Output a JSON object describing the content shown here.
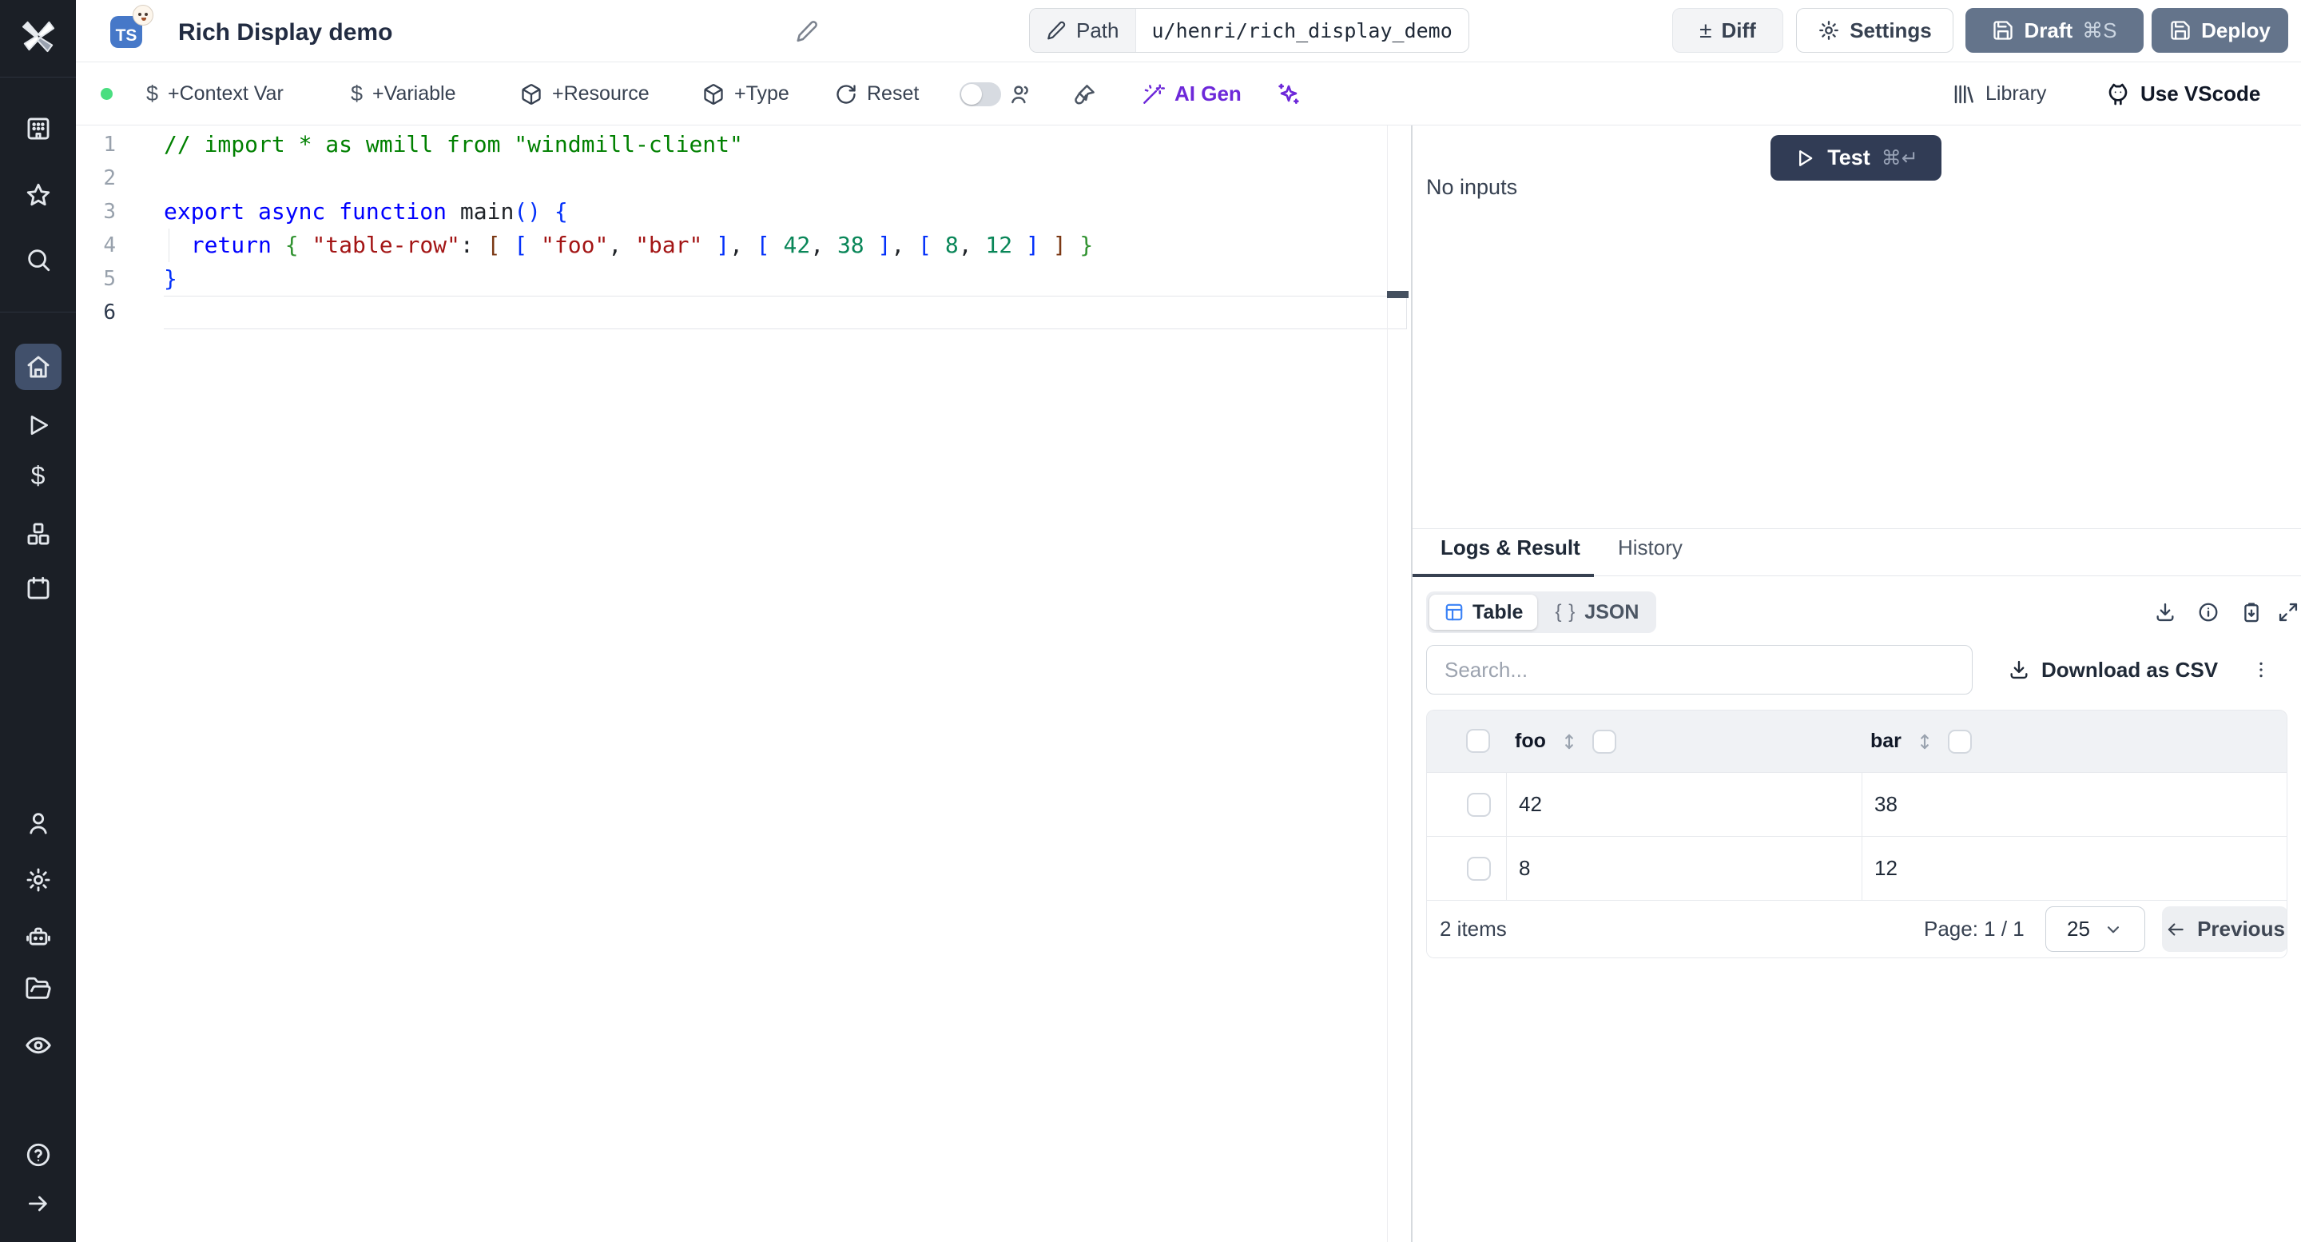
{
  "colors": {
    "accent_slate": "#64748b",
    "test_button": "#313c55",
    "ai_violet": "#6d28d9",
    "status_green": "#4ade80",
    "ts_badge_blue": "#4678c8",
    "table_icon_blue": "#3b82f6",
    "sidebar_bg": "#1b1f26"
  },
  "header": {
    "language_badge": "TS",
    "title": "Rich Display demo",
    "path_label": "Path",
    "path_value": "u/henri/rich_display_demo",
    "diff": "Diff",
    "settings": "Settings",
    "draft": "Draft",
    "draft_shortcut": "⌘S",
    "deploy": "Deploy"
  },
  "toolbar": {
    "context_var": "+Context Var",
    "variable": "+Variable",
    "resource": "+Resource",
    "type": "+Type",
    "reset": "Reset",
    "ai_gen": "AI Gen",
    "library": "Library",
    "use_vscode": "Use VScode"
  },
  "editor": {
    "active_line": 6,
    "lines": [
      {
        "tokens": [
          {
            "t": "// import * as wmill from \"windmill-client\"",
            "c": "comment"
          }
        ]
      },
      {
        "tokens": []
      },
      {
        "tokens": [
          {
            "t": "export async function ",
            "c": "kw"
          },
          {
            "t": "main",
            "c": "plain"
          },
          {
            "t": "()",
            "c": "b1"
          },
          {
            "t": " ",
            "c": "plain"
          },
          {
            "t": "{",
            "c": "b1"
          }
        ]
      },
      {
        "tokens": [
          {
            "t": "  ",
            "c": "plain"
          },
          {
            "t": "return",
            "c": "kw"
          },
          {
            "t": " ",
            "c": "plain"
          },
          {
            "t": "{",
            "c": "b2"
          },
          {
            "t": " ",
            "c": "plain"
          },
          {
            "t": "\"table-row\"",
            "c": "str"
          },
          {
            "t": ": ",
            "c": "plain"
          },
          {
            "t": "[",
            "c": "b3"
          },
          {
            "t": " ",
            "c": "plain"
          },
          {
            "t": "[",
            "c": "b1"
          },
          {
            "t": " ",
            "c": "plain"
          },
          {
            "t": "\"foo\"",
            "c": "str"
          },
          {
            "t": ", ",
            "c": "plain"
          },
          {
            "t": "\"bar\"",
            "c": "str"
          },
          {
            "t": " ",
            "c": "plain"
          },
          {
            "t": "]",
            "c": "b1"
          },
          {
            "t": ", ",
            "c": "plain"
          },
          {
            "t": "[",
            "c": "b1"
          },
          {
            "t": " ",
            "c": "plain"
          },
          {
            "t": "42",
            "c": "num"
          },
          {
            "t": ", ",
            "c": "plain"
          },
          {
            "t": "38",
            "c": "num"
          },
          {
            "t": " ",
            "c": "plain"
          },
          {
            "t": "]",
            "c": "b1"
          },
          {
            "t": ", ",
            "c": "plain"
          },
          {
            "t": "[",
            "c": "b1"
          },
          {
            "t": " ",
            "c": "plain"
          },
          {
            "t": "8",
            "c": "num"
          },
          {
            "t": ", ",
            "c": "plain"
          },
          {
            "t": "12",
            "c": "num"
          },
          {
            "t": " ",
            "c": "plain"
          },
          {
            "t": "]",
            "c": "b1"
          },
          {
            "t": " ",
            "c": "plain"
          },
          {
            "t": "]",
            "c": "b3"
          },
          {
            "t": " ",
            "c": "plain"
          },
          {
            "t": "}",
            "c": "b2"
          }
        ]
      },
      {
        "tokens": [
          {
            "t": "}",
            "c": "b1"
          }
        ]
      },
      {
        "tokens": []
      }
    ]
  },
  "run_panel": {
    "test": "Test",
    "test_shortcut": "⌘↵",
    "no_inputs": "No inputs"
  },
  "result_panel": {
    "tabs": {
      "logs_result": "Logs & Result",
      "history": "History"
    },
    "view": {
      "table": "Table",
      "json": "JSON"
    },
    "search_placeholder": "Search...",
    "download_csv": "Download as CSV",
    "table": {
      "columns": [
        "foo",
        "bar"
      ],
      "rows": [
        [
          42,
          38
        ],
        [
          8,
          12
        ]
      ]
    },
    "footer": {
      "items": "2 items",
      "page": "Page: 1 / 1",
      "page_size": "25",
      "previous": "Previous"
    }
  }
}
